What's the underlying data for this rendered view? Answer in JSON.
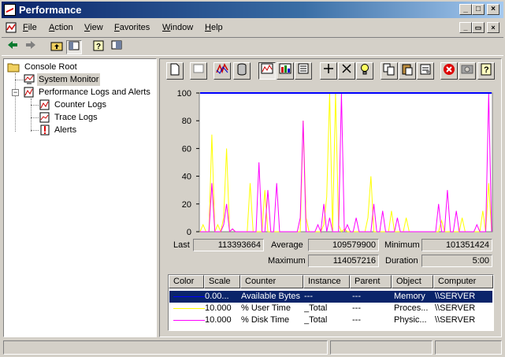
{
  "window": {
    "title": "Performance"
  },
  "menu": [
    {
      "label": "File"
    },
    {
      "label": "Action"
    },
    {
      "label": "View"
    },
    {
      "label": "Favorites"
    },
    {
      "label": "Window"
    },
    {
      "label": "Help"
    }
  ],
  "tree": {
    "root": "Console Root",
    "items": [
      {
        "label": "System Monitor",
        "icon": "system-monitor-icon",
        "selected": true
      },
      {
        "label": "Performance Logs and Alerts",
        "icon": "perf-logs-icon"
      },
      {
        "label": "Counter Logs",
        "icon": "counter-logs-icon"
      },
      {
        "label": "Trace Logs",
        "icon": "trace-logs-icon"
      },
      {
        "label": "Alerts",
        "icon": "alerts-icon"
      }
    ]
  },
  "stats": {
    "last_label": "Last",
    "last": "113393664",
    "average_label": "Average",
    "average": "109579900",
    "minimum_label": "Minimum",
    "minimum": "101351424",
    "maximum_label": "Maximum",
    "maximum": "114057216",
    "duration_label": "Duration",
    "duration": "5:00"
  },
  "legend": {
    "headers": [
      "Color",
      "Scale",
      "Counter",
      "Instance",
      "Parent",
      "Object",
      "Computer"
    ],
    "rows": [
      {
        "color": "#0000ff",
        "scale": "0.00...",
        "counter": "Available Bytes",
        "instance": "---",
        "parent": "---",
        "object": "Memory",
        "computer": "\\\\SERVER",
        "selected": true
      },
      {
        "color": "#ffff00",
        "scale": "10.000",
        "counter": "% User Time",
        "instance": "_Total",
        "parent": "---",
        "object": "Proces...",
        "computer": "\\\\SERVER"
      },
      {
        "color": "#ff00ff",
        "scale": "10.000",
        "counter": "% Disk Time",
        "instance": "_Total",
        "parent": "---",
        "object": "Physic...",
        "computer": "\\\\SERVER"
      }
    ]
  },
  "chart_data": {
    "type": "line",
    "ylim": [
      0,
      100
    ],
    "yticks": [
      "100",
      "80",
      "60",
      "40",
      "20",
      "0"
    ],
    "grid": false,
    "x": [
      0,
      1,
      2,
      3,
      4,
      5,
      6,
      7,
      8,
      9,
      10,
      11,
      12,
      13,
      14,
      15,
      16,
      17,
      18,
      19,
      20,
      21,
      22,
      23,
      24,
      25,
      26,
      27,
      28,
      29,
      30,
      31,
      32,
      33,
      34,
      35,
      36,
      37,
      38,
      39,
      40,
      41,
      42,
      43,
      44,
      45,
      46,
      47,
      48,
      49,
      50,
      51,
      52,
      53,
      54,
      55,
      56,
      57,
      58,
      59,
      60,
      61,
      62,
      63,
      64,
      65,
      66,
      67,
      68,
      69,
      70,
      71,
      72,
      73,
      74,
      75,
      76,
      77,
      78,
      79,
      80,
      81,
      82,
      83,
      84,
      85,
      86,
      87,
      88,
      89,
      90,
      91,
      92,
      93,
      94,
      95,
      96,
      97,
      98,
      99
    ],
    "series": [
      {
        "name": "Available Bytes",
        "color": "#0000ff",
        "values": [
          100,
          100,
          100,
          100,
          100,
          100,
          100,
          100,
          100,
          100,
          100,
          100,
          100,
          100,
          100,
          100,
          100,
          100,
          100,
          100,
          100,
          100,
          100,
          100,
          100,
          100,
          100,
          100,
          100,
          100,
          100,
          100,
          100,
          100,
          100,
          100,
          100,
          100,
          100,
          100,
          100,
          100,
          100,
          100,
          100,
          100,
          100,
          100,
          100,
          100,
          100,
          100,
          100,
          100,
          100,
          100,
          100,
          100,
          100,
          100,
          100,
          100,
          100,
          100,
          100,
          100,
          100,
          100,
          100,
          100,
          100,
          100,
          100,
          100,
          100,
          100,
          100,
          100,
          100,
          100,
          100,
          100,
          100,
          100,
          100,
          100,
          100,
          100,
          100,
          100,
          100,
          100,
          100,
          100,
          100,
          100,
          100,
          100,
          100,
          100
        ]
      },
      {
        "name": "% User Time",
        "color": "#ffff00",
        "values": [
          0,
          5,
          0,
          0,
          70,
          0,
          5,
          0,
          10,
          60,
          0,
          2,
          0,
          0,
          0,
          0,
          0,
          35,
          0,
          0,
          0,
          0,
          30,
          0,
          0,
          0,
          0,
          0,
          0,
          0,
          0,
          0,
          0,
          0,
          0,
          80,
          10,
          0,
          0,
          0,
          0,
          0,
          5,
          25,
          100,
          0,
          100,
          5,
          0,
          2,
          0,
          0,
          0,
          0,
          0,
          0,
          0,
          10,
          40,
          0,
          0,
          0,
          0,
          0,
          0,
          15,
          0,
          0,
          0,
          0,
          10,
          0,
          0,
          0,
          0,
          0,
          0,
          0,
          0,
          0,
          0,
          0,
          8,
          0,
          0,
          0,
          0,
          0,
          0,
          10,
          0,
          0,
          0,
          0,
          0,
          0,
          15,
          0,
          35,
          0
        ]
      },
      {
        "name": "% Disk Time",
        "color": "#ff00ff",
        "values": [
          0,
          0,
          0,
          0,
          35,
          0,
          0,
          0,
          5,
          20,
          0,
          2,
          0,
          0,
          0,
          0,
          0,
          0,
          0,
          0,
          50,
          0,
          0,
          30,
          0,
          0,
          35,
          0,
          0,
          0,
          0,
          0,
          0,
          0,
          10,
          80,
          0,
          0,
          0,
          0,
          5,
          0,
          20,
          0,
          10,
          0,
          0,
          0,
          100,
          0,
          5,
          0,
          0,
          10,
          0,
          0,
          0,
          0,
          0,
          20,
          0,
          0,
          15,
          0,
          0,
          0,
          0,
          10,
          0,
          0,
          0,
          0,
          0,
          0,
          0,
          0,
          0,
          0,
          0,
          0,
          0,
          20,
          0,
          0,
          30,
          0,
          0,
          15,
          0,
          0,
          0,
          0,
          0,
          0,
          5,
          0,
          0,
          0,
          100,
          0
        ]
      }
    ]
  }
}
